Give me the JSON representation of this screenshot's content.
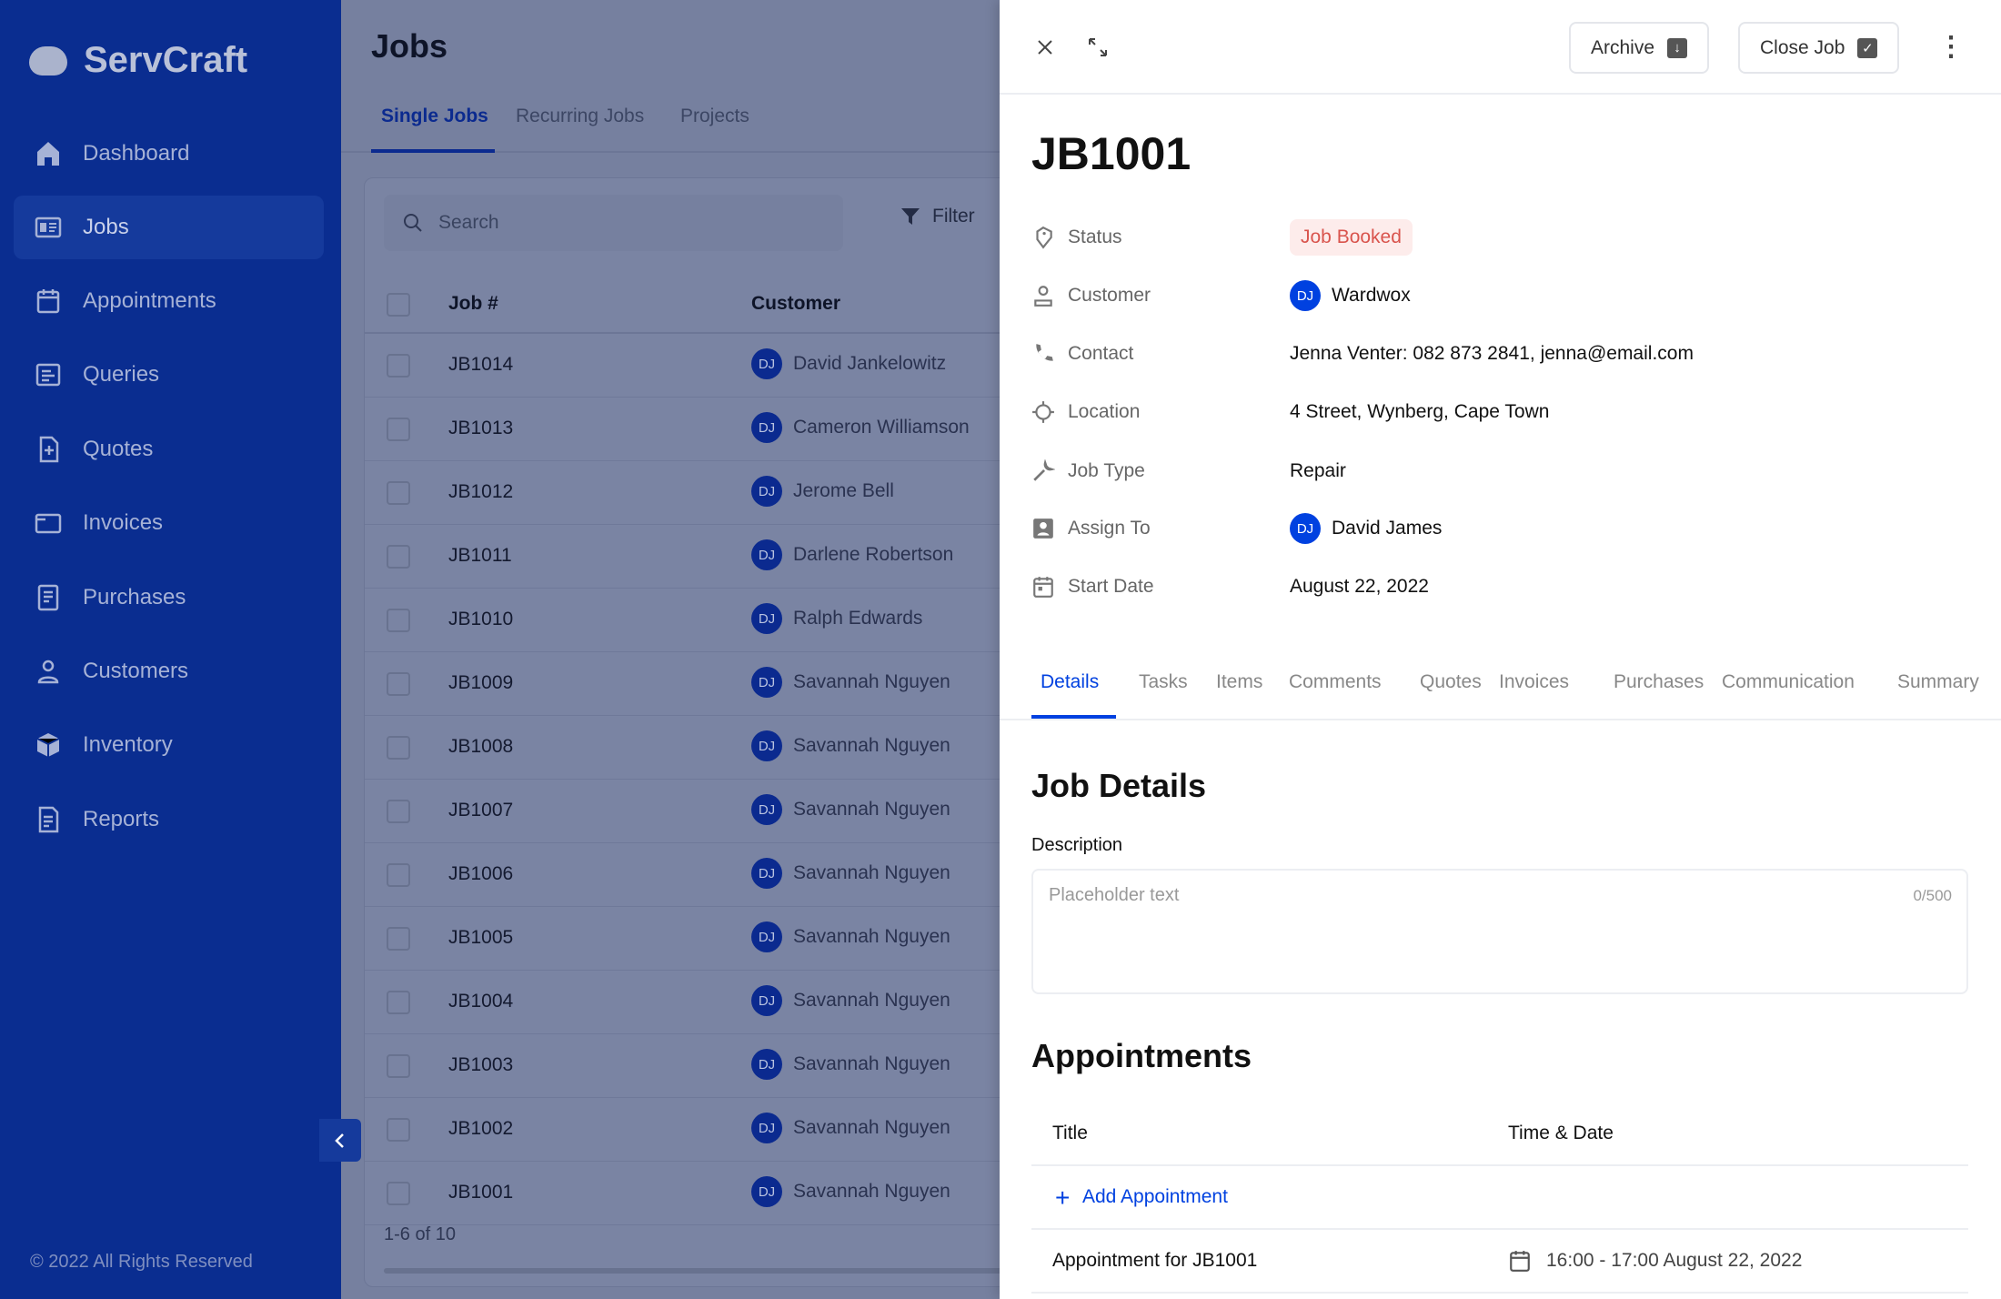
{
  "app": {
    "name": "ServCraft",
    "footer": "© 2022 All Rights Reserved"
  },
  "sidebar": {
    "items": [
      {
        "label": "Dashboard",
        "icon": "home-icon"
      },
      {
        "label": "Jobs",
        "icon": "jobs-icon",
        "active": true
      },
      {
        "label": "Appointments",
        "icon": "calendar-icon"
      },
      {
        "label": "Queries",
        "icon": "queries-icon"
      },
      {
        "label": "Quotes",
        "icon": "quotes-icon"
      },
      {
        "label": "Invoices",
        "icon": "invoices-icon"
      },
      {
        "label": "Purchases",
        "icon": "purchases-icon"
      },
      {
        "label": "Customers",
        "icon": "user-icon"
      },
      {
        "label": "Inventory",
        "icon": "box-icon"
      },
      {
        "label": "Reports",
        "icon": "reports-icon"
      }
    ]
  },
  "jobs": {
    "title": "Jobs",
    "tabs": [
      "Single Jobs",
      "Recurring Jobs",
      "Projects"
    ],
    "search_placeholder": "Search",
    "filter": "Filter",
    "columns": [
      "Job #",
      "Customer"
    ],
    "rows": [
      {
        "job": "JB1014",
        "initials": "DJ",
        "customer": "David Jankelowitz"
      },
      {
        "job": "JB1013",
        "initials": "DJ",
        "customer": "Cameron Williamson"
      },
      {
        "job": "JB1012",
        "initials": "DJ",
        "customer": "Jerome Bell"
      },
      {
        "job": "JB1011",
        "initials": "DJ",
        "customer": "Darlene Robertson"
      },
      {
        "job": "JB1010",
        "initials": "DJ",
        "customer": "Ralph Edwards"
      },
      {
        "job": "JB1009",
        "initials": "DJ",
        "customer": "Savannah Nguyen"
      },
      {
        "job": "JB1008",
        "initials": "DJ",
        "customer": "Savannah Nguyen"
      },
      {
        "job": "JB1007",
        "initials": "DJ",
        "customer": "Savannah Nguyen"
      },
      {
        "job": "JB1006",
        "initials": "DJ",
        "customer": "Savannah Nguyen"
      },
      {
        "job": "JB1005",
        "initials": "DJ",
        "customer": "Savannah Nguyen"
      },
      {
        "job": "JB1004",
        "initials": "DJ",
        "customer": "Savannah Nguyen"
      },
      {
        "job": "JB1003",
        "initials": "DJ",
        "customer": "Savannah Nguyen"
      },
      {
        "job": "JB1002",
        "initials": "DJ",
        "customer": "Savannah Nguyen"
      },
      {
        "job": "JB1001",
        "initials": "DJ",
        "customer": "Savannah Nguyen"
      }
    ],
    "pagination": "1-6 of 10"
  },
  "panel": {
    "archive": "Archive",
    "close_job": "Close Job",
    "title": "JB1001",
    "fields": {
      "status": {
        "label": "Status",
        "value": "Job Booked"
      },
      "customer": {
        "label": "Customer",
        "initials": "DJ",
        "value": "Wardwox"
      },
      "contact": {
        "label": "Contact",
        "value": "Jenna Venter: 082 873 2841, jenna@email.com"
      },
      "location": {
        "label": "Location",
        "value": "4 Street, Wynberg, Cape Town"
      },
      "job_type": {
        "label": "Job Type",
        "value": "Repair"
      },
      "assign_to": {
        "label": "Assign To",
        "initials": "DJ",
        "value": "David James"
      },
      "start_date": {
        "label": "Start Date",
        "value": "August 22, 2022"
      }
    },
    "tabs": [
      "Details",
      "Tasks",
      "Items",
      "Comments",
      "Quotes",
      "Invoices",
      "Purchases",
      "Communication",
      "Summary"
    ],
    "job_details": {
      "heading": "Job Details",
      "description_label": "Description",
      "placeholder": "Placeholder text",
      "counter": "0/500"
    },
    "appointments": {
      "heading": "Appointments",
      "columns": [
        "Title",
        "Time & Date"
      ],
      "add": "Add Appointment",
      "rows": [
        {
          "title": "Appointment for JB1001",
          "time": "16:00 - 17:00 August 22, 2022"
        }
      ]
    }
  },
  "colors": {
    "brand": "#0041e0",
    "status_badge_bg": "#fdeceb",
    "status_badge_text": "#d9544d"
  }
}
